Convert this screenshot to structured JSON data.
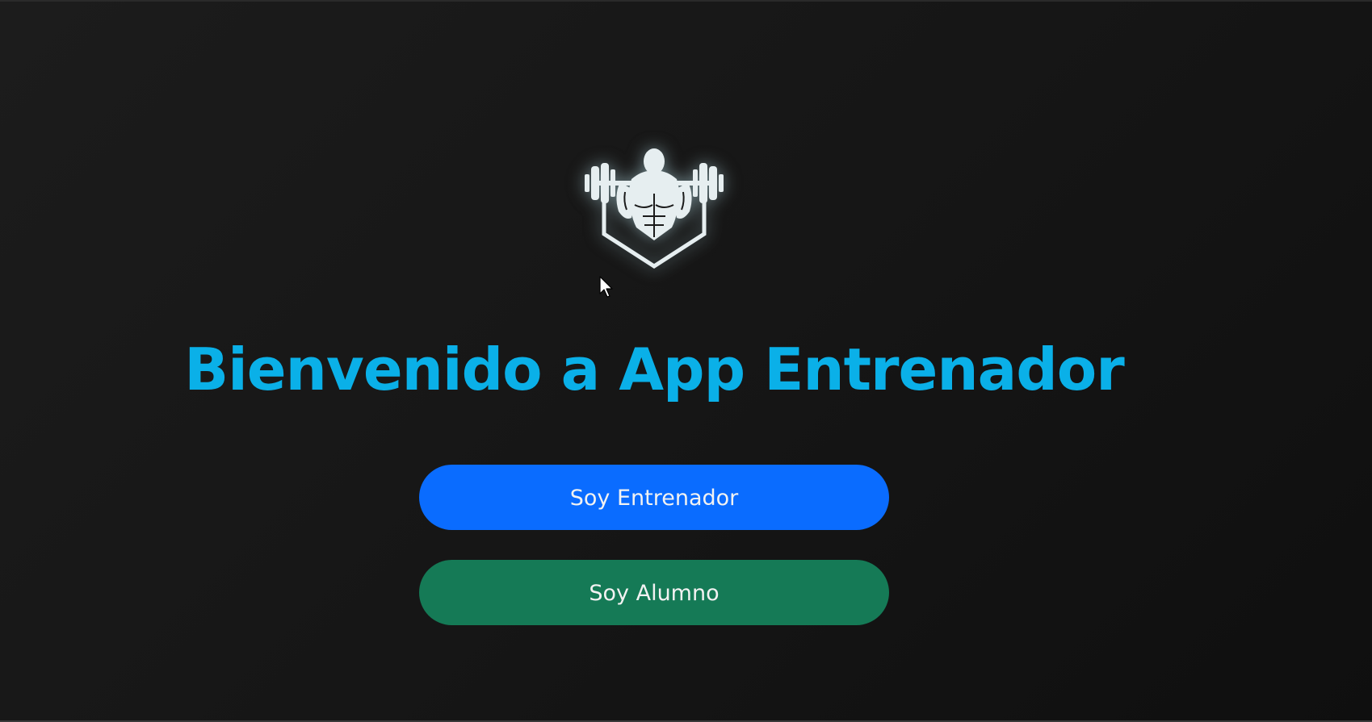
{
  "page": {
    "background_color": "#161616",
    "accent_color": "#0ab0e8"
  },
  "logo": {
    "icon": "weightlifter-icon"
  },
  "title": "Bienvenido a App Entrenador",
  "buttons": {
    "trainer": {
      "label": "Soy Entrenador",
      "color": "#0a6cff"
    },
    "student": {
      "label": "Soy Alumno",
      "color": "#157a56"
    }
  }
}
